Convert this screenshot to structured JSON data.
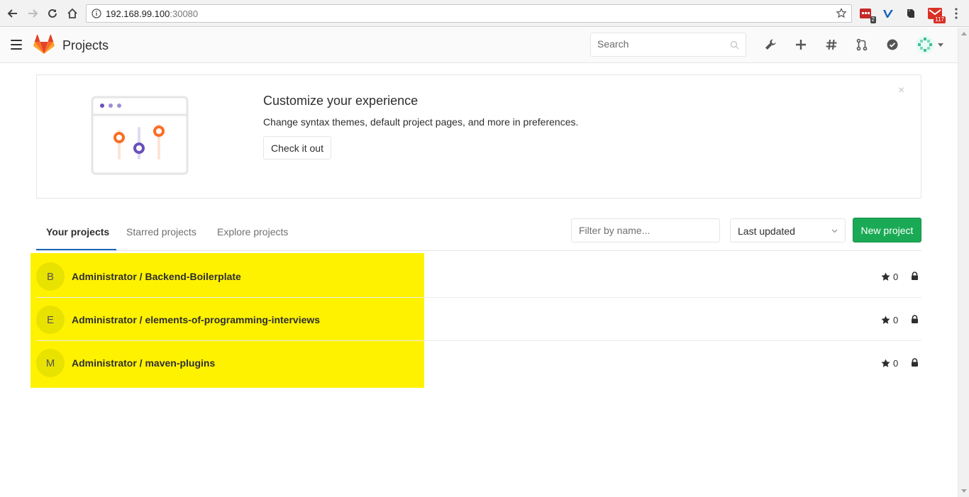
{
  "browser": {
    "url_host": "192.168.99.100",
    "url_port": ":30080",
    "extensions": [
      {
        "name": "calendar-extension-icon",
        "badge": "2"
      },
      {
        "name": "vimeo-extension-icon",
        "badge": ""
      },
      {
        "name": "evernote-extension-icon",
        "badge": ""
      },
      {
        "name": "gmail-extension-icon",
        "badge": "117"
      }
    ]
  },
  "header": {
    "title": "Projects",
    "search_placeholder": "Search"
  },
  "callout": {
    "title": "Customize your experience",
    "description": "Change syntax themes, default project pages, and more in preferences.",
    "button_label": "Check it out",
    "close_glyph": "×"
  },
  "tabs": [
    {
      "label": "Your projects",
      "active": true
    },
    {
      "label": "Starred projects",
      "active": false
    },
    {
      "label": "Explore projects",
      "active": false
    }
  ],
  "filter": {
    "placeholder": "Filter by name...",
    "sort_selected": "Last updated",
    "new_project_label": "New project"
  },
  "projects": [
    {
      "initial": "B",
      "name": "Administrator / Backend-Boilerplate",
      "stars": "0"
    },
    {
      "initial": "E",
      "name": "Administrator / elements-of-programming-interviews",
      "stars": "0"
    },
    {
      "initial": "M",
      "name": "Administrator / maven-plugins",
      "stars": "0"
    }
  ],
  "colors": {
    "highlight": "#fff200",
    "primary_button": "#1aaa55",
    "active_tab_underline": "#1b69b6",
    "gitlab_orange": "#fc6d26"
  }
}
